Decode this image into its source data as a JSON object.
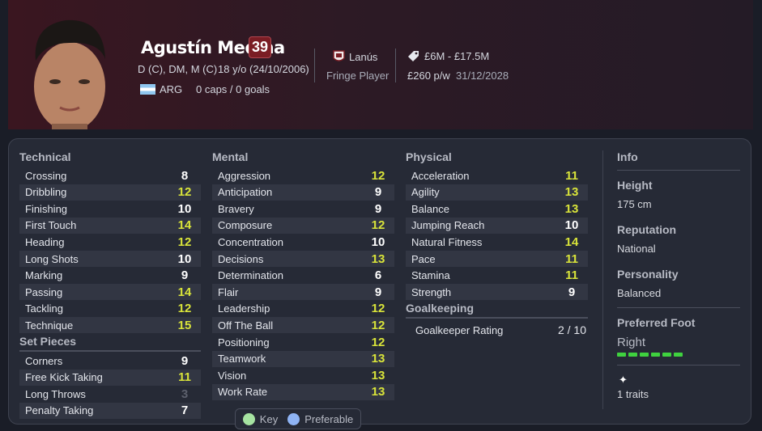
{
  "player": {
    "name": "Agustín Medina",
    "ca": "39",
    "positions": "D (C), DM, M (C)",
    "age_dob": "18 y/o (24/10/2006)",
    "nation": "ARG",
    "caps_goals": "0 caps / 0 goals",
    "club": "Lanús",
    "squad_status": "Fringe Player",
    "value": "£6M - £17.5M",
    "wage": "£260 p/w",
    "contract_end": "31/12/2028"
  },
  "colors": {
    "accent_yellow": "#d9e43a",
    "faded": "#5c606d",
    "foot_green": "#3fd23f",
    "key_green": "#a6e3a1",
    "preferable_blue": "#8fb4f5"
  },
  "technical": {
    "title": "Technical",
    "items": [
      {
        "label": "Crossing",
        "value": "8"
      },
      {
        "label": "Dribbling",
        "value": "12"
      },
      {
        "label": "Finishing",
        "value": "10"
      },
      {
        "label": "First Touch",
        "value": "14"
      },
      {
        "label": "Heading",
        "value": "12"
      },
      {
        "label": "Long Shots",
        "value": "10"
      },
      {
        "label": "Marking",
        "value": "9"
      },
      {
        "label": "Passing",
        "value": "14"
      },
      {
        "label": "Tackling",
        "value": "12"
      },
      {
        "label": "Technique",
        "value": "15"
      }
    ]
  },
  "set_pieces": {
    "title": "Set Pieces",
    "items": [
      {
        "label": "Corners",
        "value": "9"
      },
      {
        "label": "Free Kick Taking",
        "value": "11"
      },
      {
        "label": "Long Throws",
        "value": "3"
      },
      {
        "label": "Penalty Taking",
        "value": "7"
      }
    ]
  },
  "mental": {
    "title": "Mental",
    "items": [
      {
        "label": "Aggression",
        "value": "12"
      },
      {
        "label": "Anticipation",
        "value": "9"
      },
      {
        "label": "Bravery",
        "value": "9"
      },
      {
        "label": "Composure",
        "value": "12"
      },
      {
        "label": "Concentration",
        "value": "10"
      },
      {
        "label": "Decisions",
        "value": "13"
      },
      {
        "label": "Determination",
        "value": "6"
      },
      {
        "label": "Flair",
        "value": "9"
      },
      {
        "label": "Leadership",
        "value": "12"
      },
      {
        "label": "Off The Ball",
        "value": "12"
      },
      {
        "label": "Positioning",
        "value": "12"
      },
      {
        "label": "Teamwork",
        "value": "13"
      },
      {
        "label": "Vision",
        "value": "13"
      },
      {
        "label": "Work Rate",
        "value": "13"
      }
    ]
  },
  "physical": {
    "title": "Physical",
    "items": [
      {
        "label": "Acceleration",
        "value": "11"
      },
      {
        "label": "Agility",
        "value": "13"
      },
      {
        "label": "Balance",
        "value": "13"
      },
      {
        "label": "Jumping Reach",
        "value": "10"
      },
      {
        "label": "Natural Fitness",
        "value": "14"
      },
      {
        "label": "Pace",
        "value": "11"
      },
      {
        "label": "Stamina",
        "value": "11"
      },
      {
        "label": "Strength",
        "value": "9"
      }
    ]
  },
  "goalkeeping": {
    "title": "Goalkeeping",
    "rating_label": "Goalkeeper Rating",
    "rating_value": "2 / 10"
  },
  "info": {
    "title": "Info",
    "height_label": "Height",
    "height": "175 cm",
    "reputation_label": "Reputation",
    "reputation": "National",
    "personality_label": "Personality",
    "personality": "Balanced",
    "foot_label": "Preferred Foot",
    "foot": "Right",
    "traits": "1 traits"
  },
  "legend": {
    "key": "Key",
    "preferable": "Preferable"
  }
}
